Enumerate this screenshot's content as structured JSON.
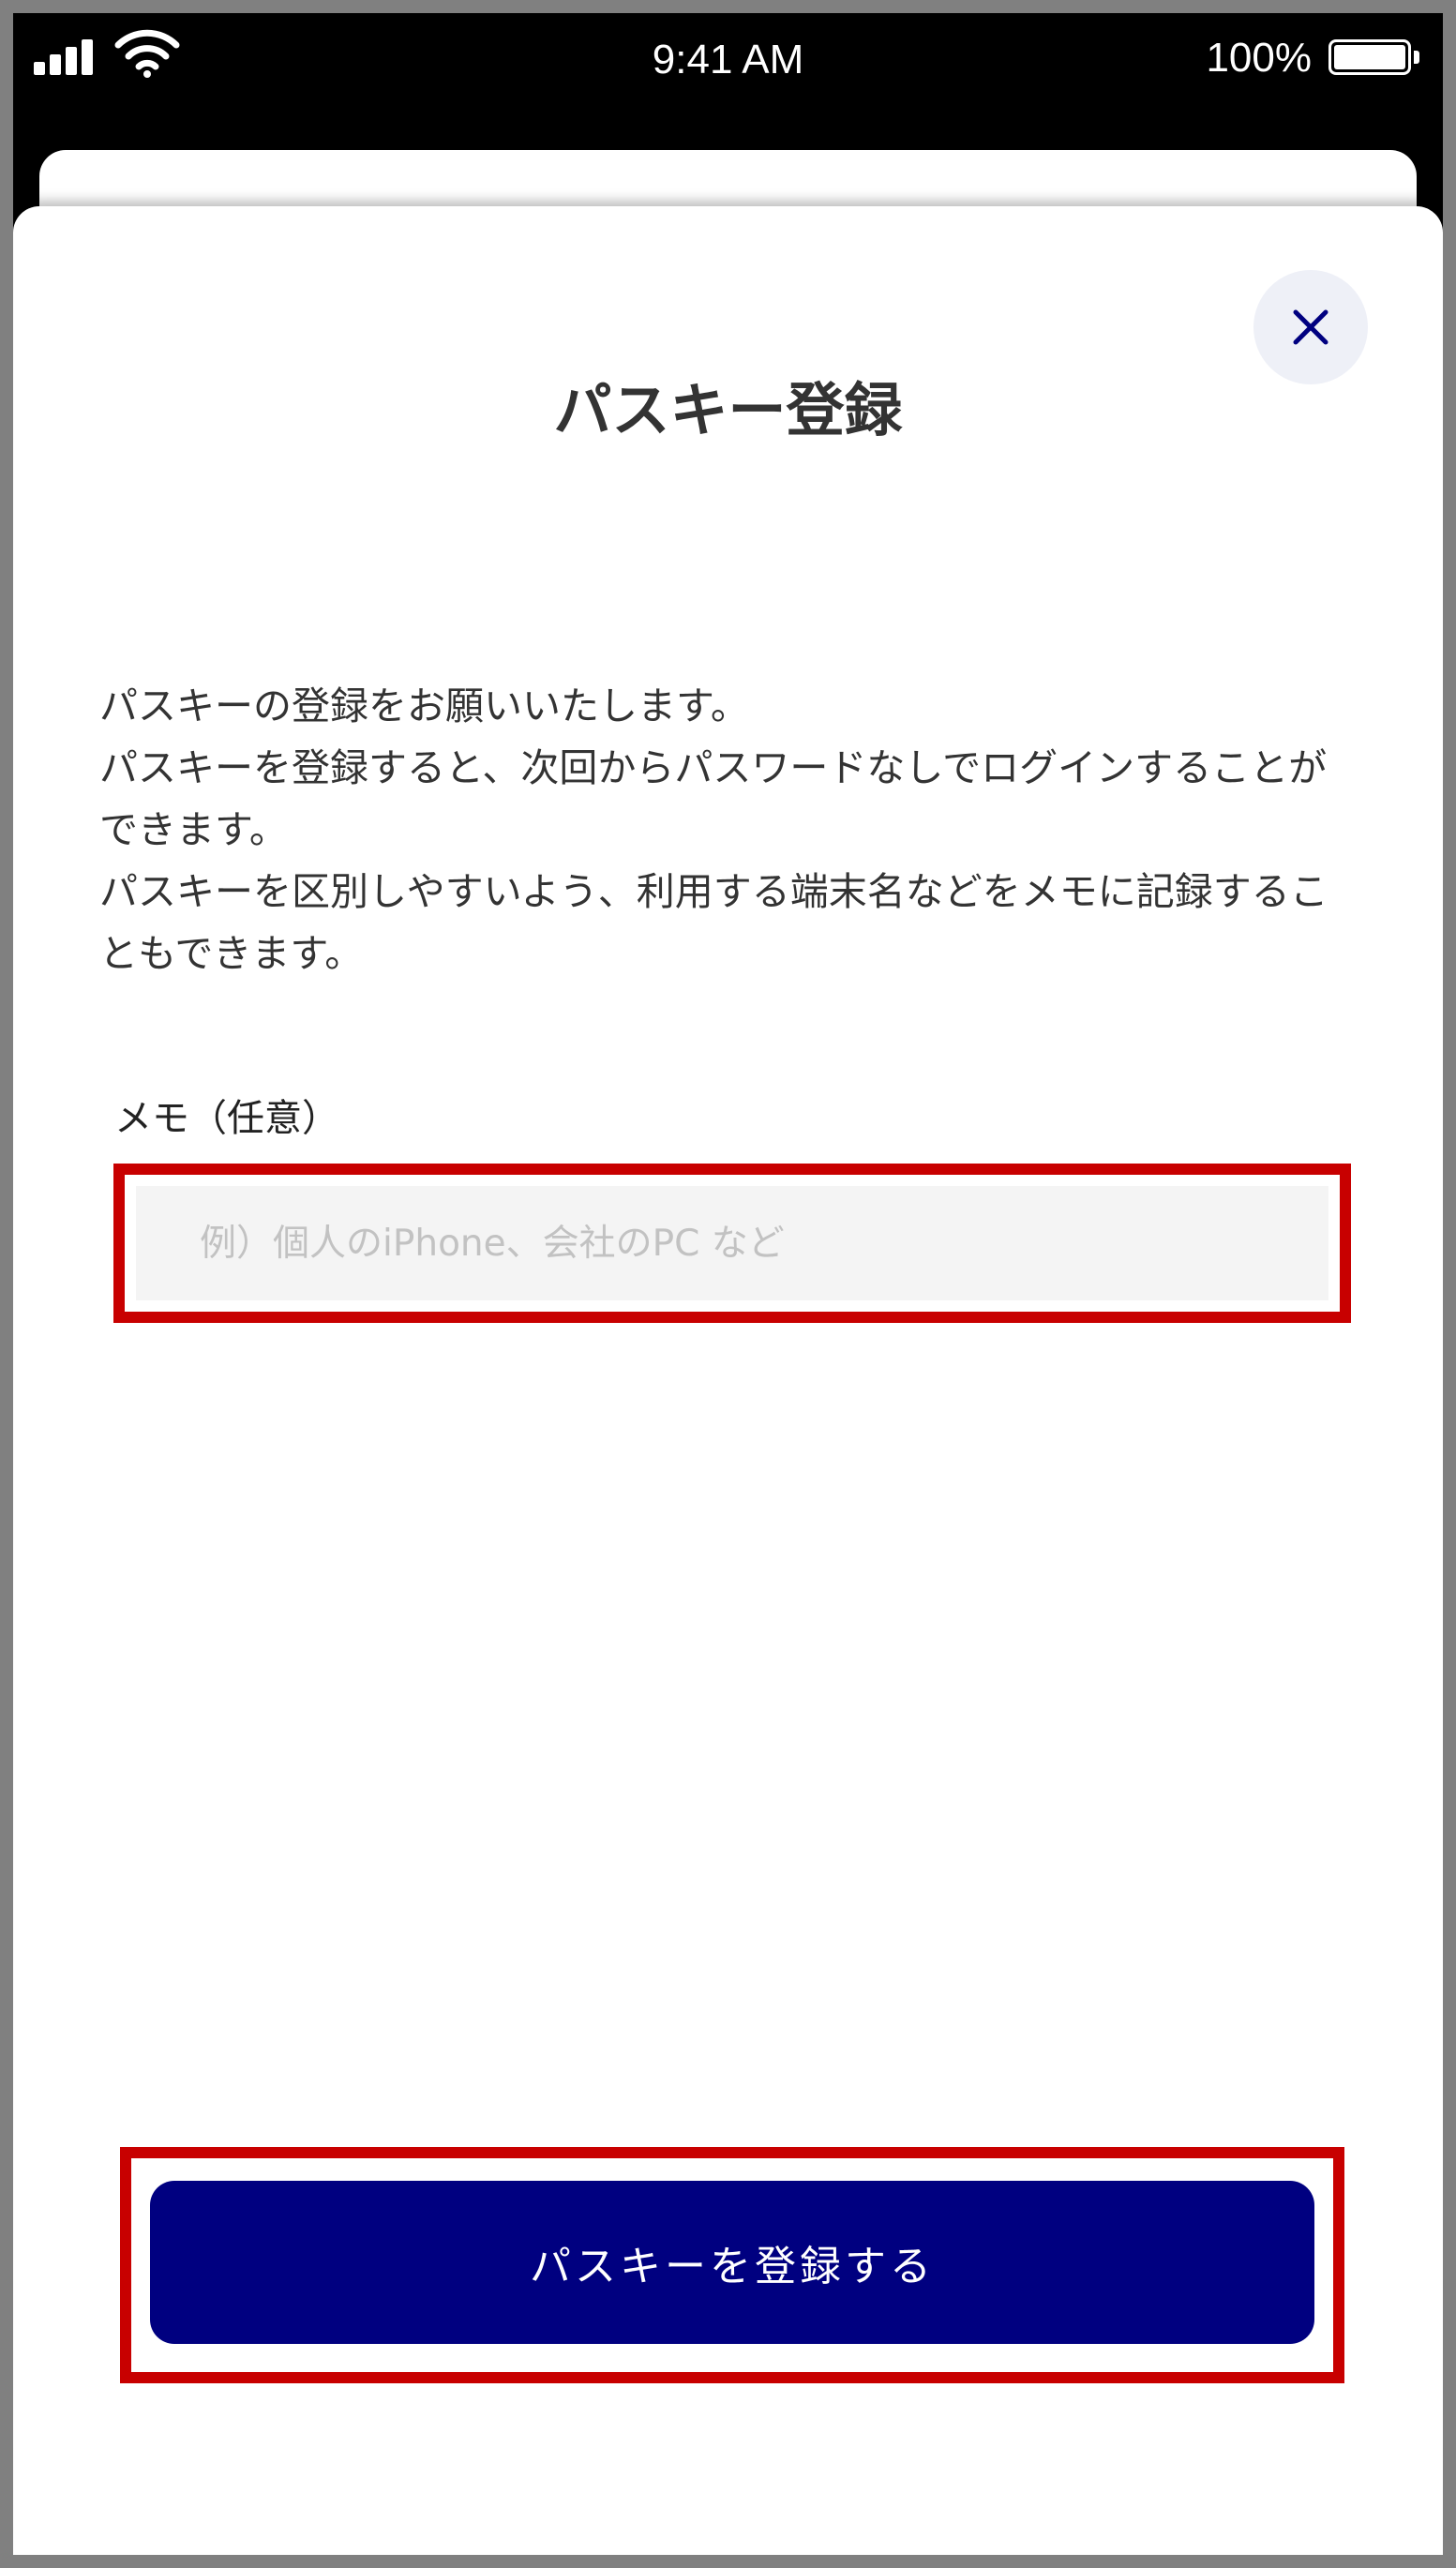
{
  "status_bar": {
    "time": "9:41 AM",
    "battery": "100%",
    "battery_level": 1.0,
    "signal_icon": "cellular-signal-icon",
    "wifi_icon": "wifi-icon",
    "battery_icon": "battery-icon"
  },
  "dialog": {
    "title": "パスキー登録",
    "close_icon": "close-icon",
    "description": [
      "パスキーの登録をお願いいたします。",
      "パスキーを登録すると、次回からパスワードなしでログインすることができます。",
      "パスキーを区別しやすいよう、利用する端末名などをメモに記録することもできます。"
    ],
    "memo": {
      "label": "メモ（任意）",
      "value": "",
      "placeholder": "例）個人のiPhone、会社のPC など"
    },
    "submit_label": "パスキーを登録する"
  },
  "colors": {
    "primary_button": "#000080",
    "highlight_border": "#c80000",
    "close_icon": "#000080",
    "close_button_bg": "#eef0f7",
    "input_bg": "#f4f4f4"
  }
}
